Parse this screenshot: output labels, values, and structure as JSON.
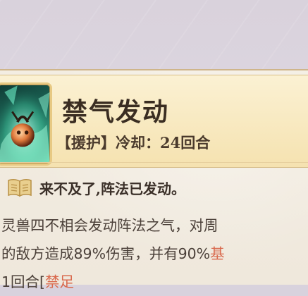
{
  "skill": {
    "name": "禁气发动",
    "meta": "【援护】冷却：24回合",
    "quote": "来不及了,阵法已发动。",
    "desc": {
      "line1": "灵兽四不相会发动阵法之气，对周",
      "line2_a": "的敌方造成89%伤害，并有90%",
      "line2_b": "基",
      "line3_a": "1回合[",
      "line3_b": "禁足"
    }
  },
  "icons": {
    "skill_icon": "spirit-beast-skill-icon",
    "book_icon": "book-icon"
  },
  "colors": {
    "header_bg": "#f5e2b0",
    "highlight": "#d9694d",
    "text": "#3a2d22"
  }
}
